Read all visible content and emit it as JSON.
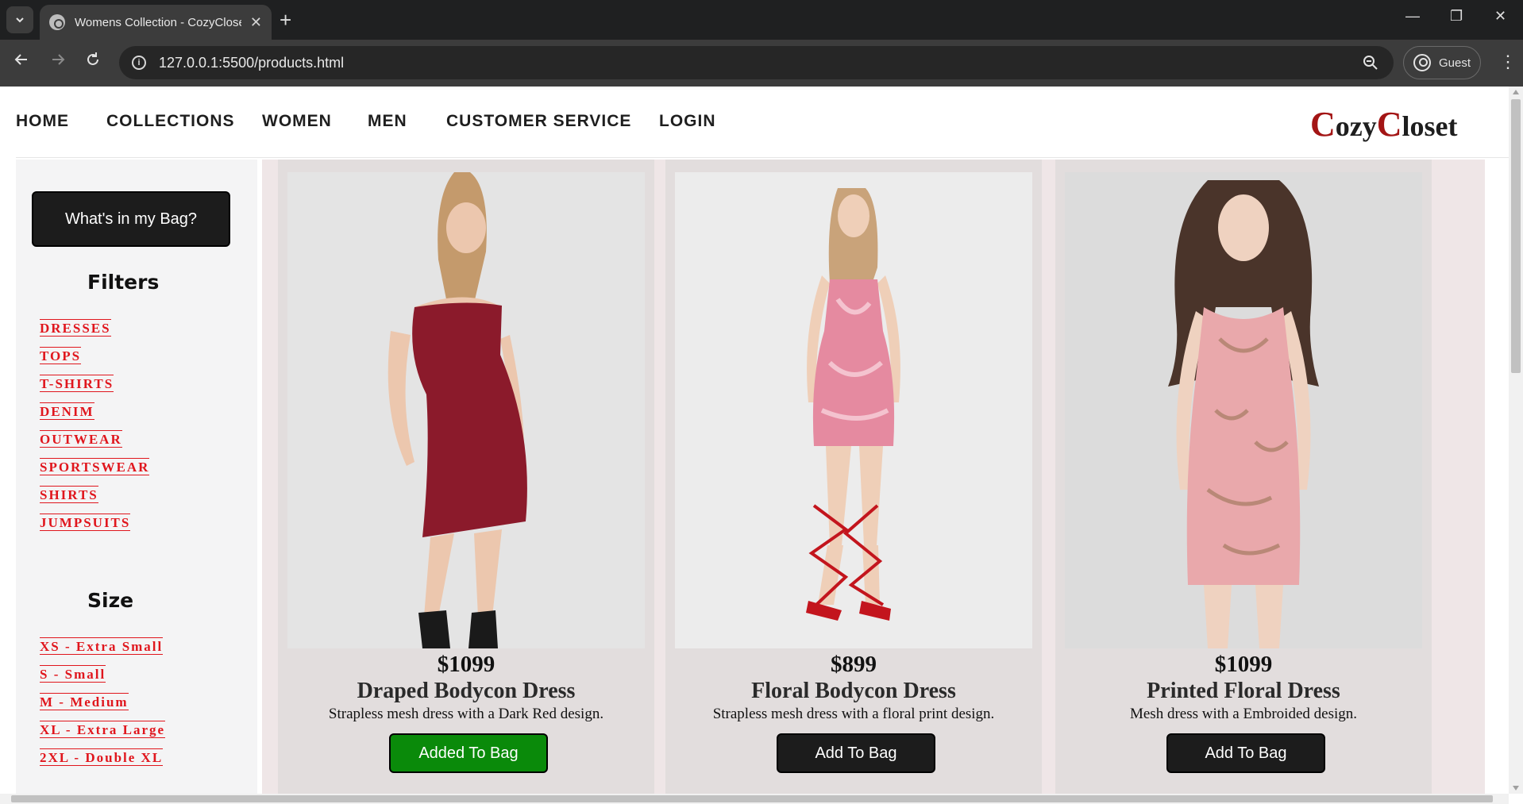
{
  "browser": {
    "tab_title": "Womens Collection - CozyCloset",
    "url": "127.0.0.1:5500/products.html",
    "profile_label": "Guest"
  },
  "nav": {
    "links": [
      "HOME",
      "COLLECTIONS",
      "WOMEN",
      "MEN",
      "CUSTOMER SERVICE",
      "LOGIN"
    ],
    "brand_first_cap": "C",
    "brand_first_rest": "ozy",
    "brand_second_cap": "C",
    "brand_second_rest": "loset"
  },
  "sidebar": {
    "bag_button": "What's in my Bag?",
    "filters_heading": "Filters",
    "filters": [
      "DRESSES",
      "TOPS",
      "T-SHIRTS",
      "DENIM",
      "OUTWEAR",
      "SPORTSWEAR",
      "SHIRTS",
      "JUMPSUITS"
    ],
    "size_heading": "Size",
    "sizes": [
      "XS - Extra Small",
      "S - Small",
      "M - Medium",
      "XL - Extra Large",
      "2XL - Double XL"
    ]
  },
  "products": [
    {
      "price": "$1099",
      "name": "Draped Bodycon Dress",
      "description": "Strapless mesh dress with a Dark Red design.",
      "button": "Added To Bag",
      "dress_color": "#8b1a2b"
    },
    {
      "price": "$899",
      "name": "Floral Bodycon Dress",
      "description": "Strapless mesh dress with a floral print design.",
      "button": "Add To Bag",
      "dress_color": "#e58aa0"
    },
    {
      "price": "$1099",
      "name": "Printed Floral Dress",
      "description": "Mesh dress with a Embroided design.",
      "button": "Add To Bag",
      "dress_color": "#e9a8ab"
    }
  ],
  "colors": {
    "accent_red": "#e0161d",
    "brand_red": "#a31515",
    "added_green": "#0a8a0a"
  }
}
